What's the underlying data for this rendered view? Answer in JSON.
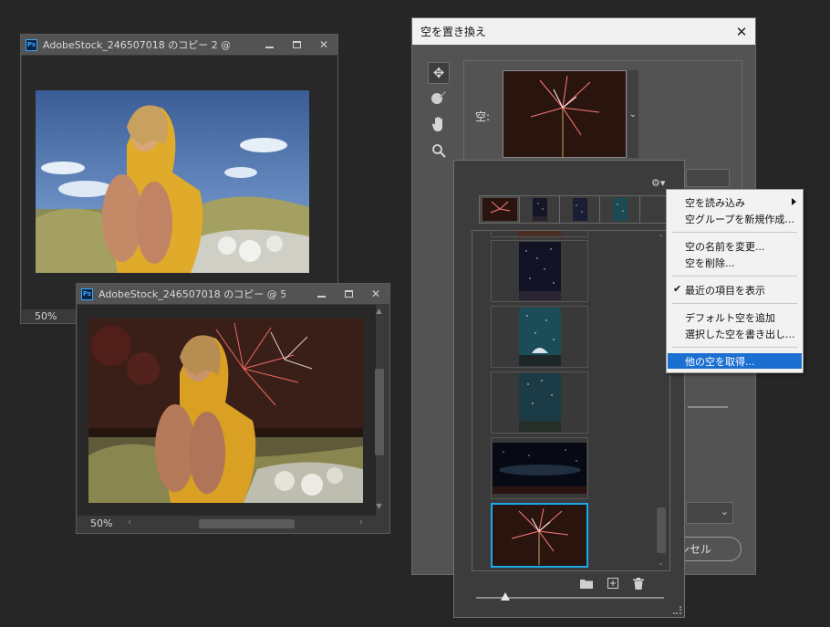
{
  "window1": {
    "title": "AdobeStock_246507018 のコピー 2 @ 5...",
    "zoom": "50%"
  },
  "window2": {
    "title": "AdobeStock_246507018 のコピー @ 5...",
    "zoom": "50%"
  },
  "window_controls": {
    "minimize": "",
    "maximize": "",
    "close": "✕"
  },
  "dialog": {
    "title": "空を置き換え",
    "close": "✕",
    "sky_label": "空:",
    "cancel_label": "ンセル"
  },
  "tools": {
    "move": "✥",
    "brush": "🖌",
    "hand": "✋",
    "zoom": "🔍"
  },
  "picker": {
    "gear": "⚙▾",
    "folder_icon": "▰",
    "new_icon": "⊞",
    "trash_icon": "🗑"
  },
  "menu": {
    "items": [
      {
        "label": "空を読み込み",
        "submenu": true
      },
      {
        "label": "空グループを新規作成..."
      },
      {
        "label": "空の名前を変更..."
      },
      {
        "label": "空を削除..."
      },
      {
        "label": "最近の項目を表示",
        "checked": true
      },
      {
        "label": "デフォルト空を追加"
      },
      {
        "label": "選択した空を書き出し..."
      },
      {
        "label": "他の空を取得...",
        "highlighted": true
      }
    ]
  },
  "colors": {
    "app_bg": "#262626",
    "panel": "#535353",
    "selection_blue": "#1fa7e6",
    "menu_highlight": "#1b6fd1"
  }
}
